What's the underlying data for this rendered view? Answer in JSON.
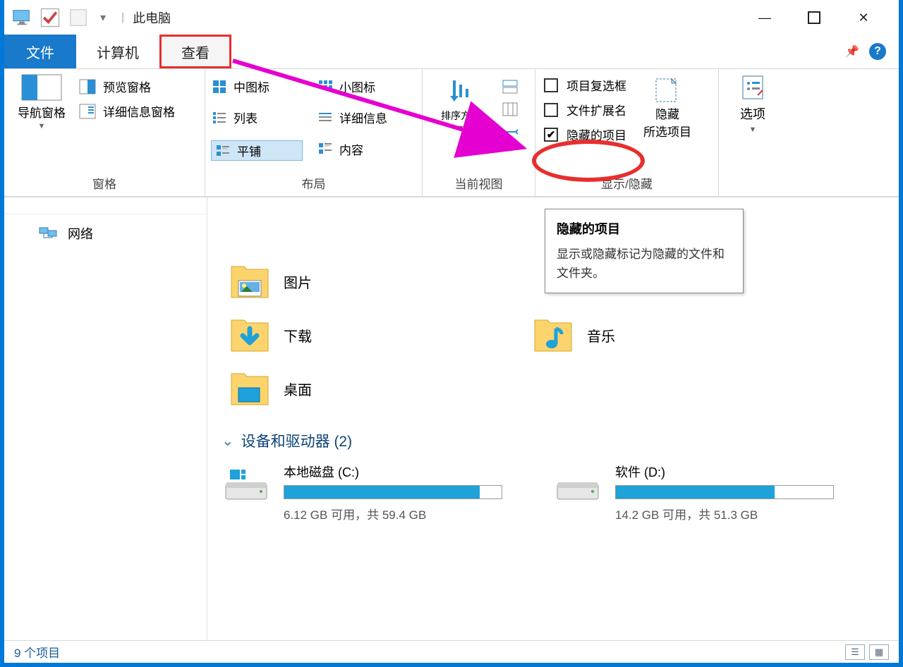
{
  "title": "此电脑",
  "tabs": {
    "file": "文件",
    "computer": "计算机",
    "view": "查看"
  },
  "ribbon": {
    "panes": {
      "label": "窗格",
      "nav": "导航窗格",
      "preview": "预览窗格",
      "details": "详细信息窗格"
    },
    "layout": {
      "label": "布局",
      "medium": "中图标",
      "small": "小图标",
      "list": "列表",
      "details": "详细信息",
      "tiles": "平铺",
      "content": "内容"
    },
    "currentview": {
      "label": "当前视图",
      "sort": "排序方式"
    },
    "showhide": {
      "label": "显示/隐藏",
      "cb_checkbox": "项目复选框",
      "cb_ext": "文件扩展名",
      "cb_hidden": "隐藏的项目",
      "hide": "隐藏",
      "hide2": "所选项目"
    },
    "options": "选项"
  },
  "tooltip": {
    "title": "隐藏的项目",
    "body": "显示或隐藏标记为隐藏的文件和文件夹。"
  },
  "sidebar": {
    "network": "网络"
  },
  "folders": {
    "pictures": "图片",
    "downloads": "下载",
    "desktop": "桌面",
    "music": "音乐"
  },
  "group": {
    "devices": "设备和驱动器 (2)"
  },
  "drives": [
    {
      "name": "本地磁盘 (C:)",
      "free": "6.12 GB 可用，共 59.4 GB",
      "fill": 90
    },
    {
      "name": "软件 (D:)",
      "free": "14.2 GB 可用，共 51.3 GB",
      "fill": 73
    }
  ],
  "status": "9 个项目"
}
